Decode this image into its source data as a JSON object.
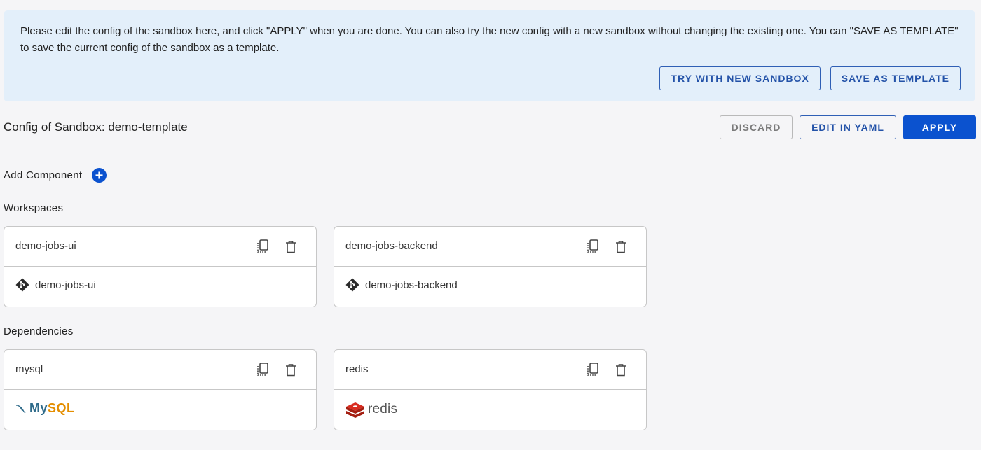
{
  "banner": {
    "text": "Please edit the config of the sandbox here, and click \"APPLY\" when you are done. You can also try the new config with a new sandbox without changing the existing one. You can \"SAVE AS TEMPLATE\" to save the current config of the sandbox as a template.",
    "try_new_label": "TRY WITH NEW SANDBOX",
    "save_template_label": "SAVE AS TEMPLATE"
  },
  "config": {
    "title": "Config of Sandbox: demo-template",
    "discard_label": "DISCARD",
    "edit_yaml_label": "EDIT IN YAML",
    "apply_label": "APPLY"
  },
  "add_component": {
    "label": "Add Component"
  },
  "workspaces": {
    "title": "Workspaces",
    "items": [
      {
        "name": "demo-jobs-ui",
        "repo": "demo-jobs-ui",
        "icon": "git-icon"
      },
      {
        "name": "demo-jobs-backend",
        "repo": "demo-jobs-backend",
        "icon": "git-icon"
      }
    ]
  },
  "dependencies": {
    "title": "Dependencies",
    "items": [
      {
        "name": "mysql",
        "logo_my": "My",
        "logo_sql": "SQL",
        "icon": "mysql-logo"
      },
      {
        "name": "redis",
        "logo_text": "redis",
        "icon": "redis-logo"
      }
    ]
  },
  "colors": {
    "banner_bg": "#e3effa",
    "primary": "#0b52cf",
    "outline": "#2f5fb5",
    "mysql_blue": "#2f6b8a",
    "mysql_orange": "#e48e00",
    "redis_red": "#d82c20"
  }
}
